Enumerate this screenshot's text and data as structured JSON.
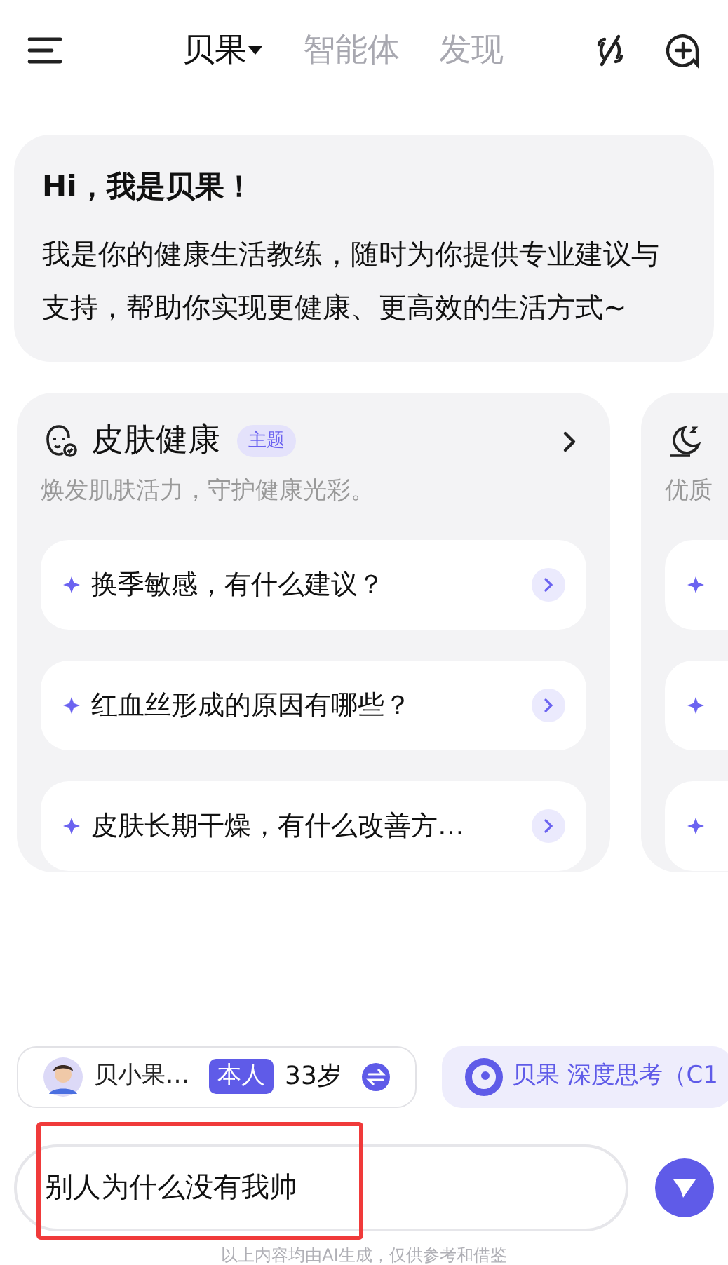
{
  "header": {
    "tabs": [
      {
        "label": "贝果",
        "selected": true,
        "dropdown": true
      },
      {
        "label": "智能体",
        "selected": false,
        "dropdown": false
      },
      {
        "label": "发现",
        "selected": false,
        "dropdown": false
      }
    ]
  },
  "greeting": {
    "title": "Hi，我是贝果！",
    "body": "我是你的健康生活教练，随时为你提供专业建议与支持，帮助你实现更健康、更高效的生活方式~"
  },
  "topic_cards": [
    {
      "kind": "skin",
      "title": "皮肤健康",
      "badge": "主题",
      "subtitle": "焕发肌肤活力，守护健康光彩。",
      "questions": [
        {
          "kind": "question",
          "text": "换季敏感，有什么建议？"
        },
        {
          "kind": "question",
          "text": "红血丝形成的原因有哪些？"
        },
        {
          "kind": "question",
          "text": "皮肤长期干燥，有什么改善方…"
        }
      ]
    },
    {
      "kind": "sleep",
      "subtitle": "优质",
      "questions": [
        {
          "kind": "clipped"
        },
        {
          "kind": "clipped"
        },
        {
          "kind": "clipped"
        }
      ]
    }
  ],
  "profile_chip": {
    "name": "贝小果…",
    "tag": "本人",
    "age": "33岁"
  },
  "model_chip": {
    "label": "贝果 深度思考（C1"
  },
  "input": {
    "value": "别人为什么没有我帅"
  },
  "disclaimer": "以上内容均由AI生成，仅供参考和借鉴",
  "annotation": {
    "kind": "highlight"
  }
}
